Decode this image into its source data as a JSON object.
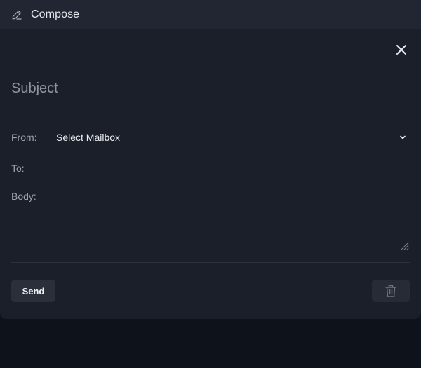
{
  "window": {
    "title": "Compose",
    "title_icon": "pencil-icon",
    "close_icon": "close-icon"
  },
  "form": {
    "subject_placeholder": "Subject",
    "from_label": "From:",
    "from_value": "Select Mailbox",
    "from_icon": "chevron-down-icon",
    "to_label": "To:",
    "body_label": "Body:"
  },
  "actions": {
    "send_label": "Send",
    "delete_icon": "trash-icon"
  },
  "colors": {
    "background": "#0e121b",
    "titlebar": "#222632",
    "panel": "#1b1f2a",
    "button": "#2a2f3a"
  }
}
